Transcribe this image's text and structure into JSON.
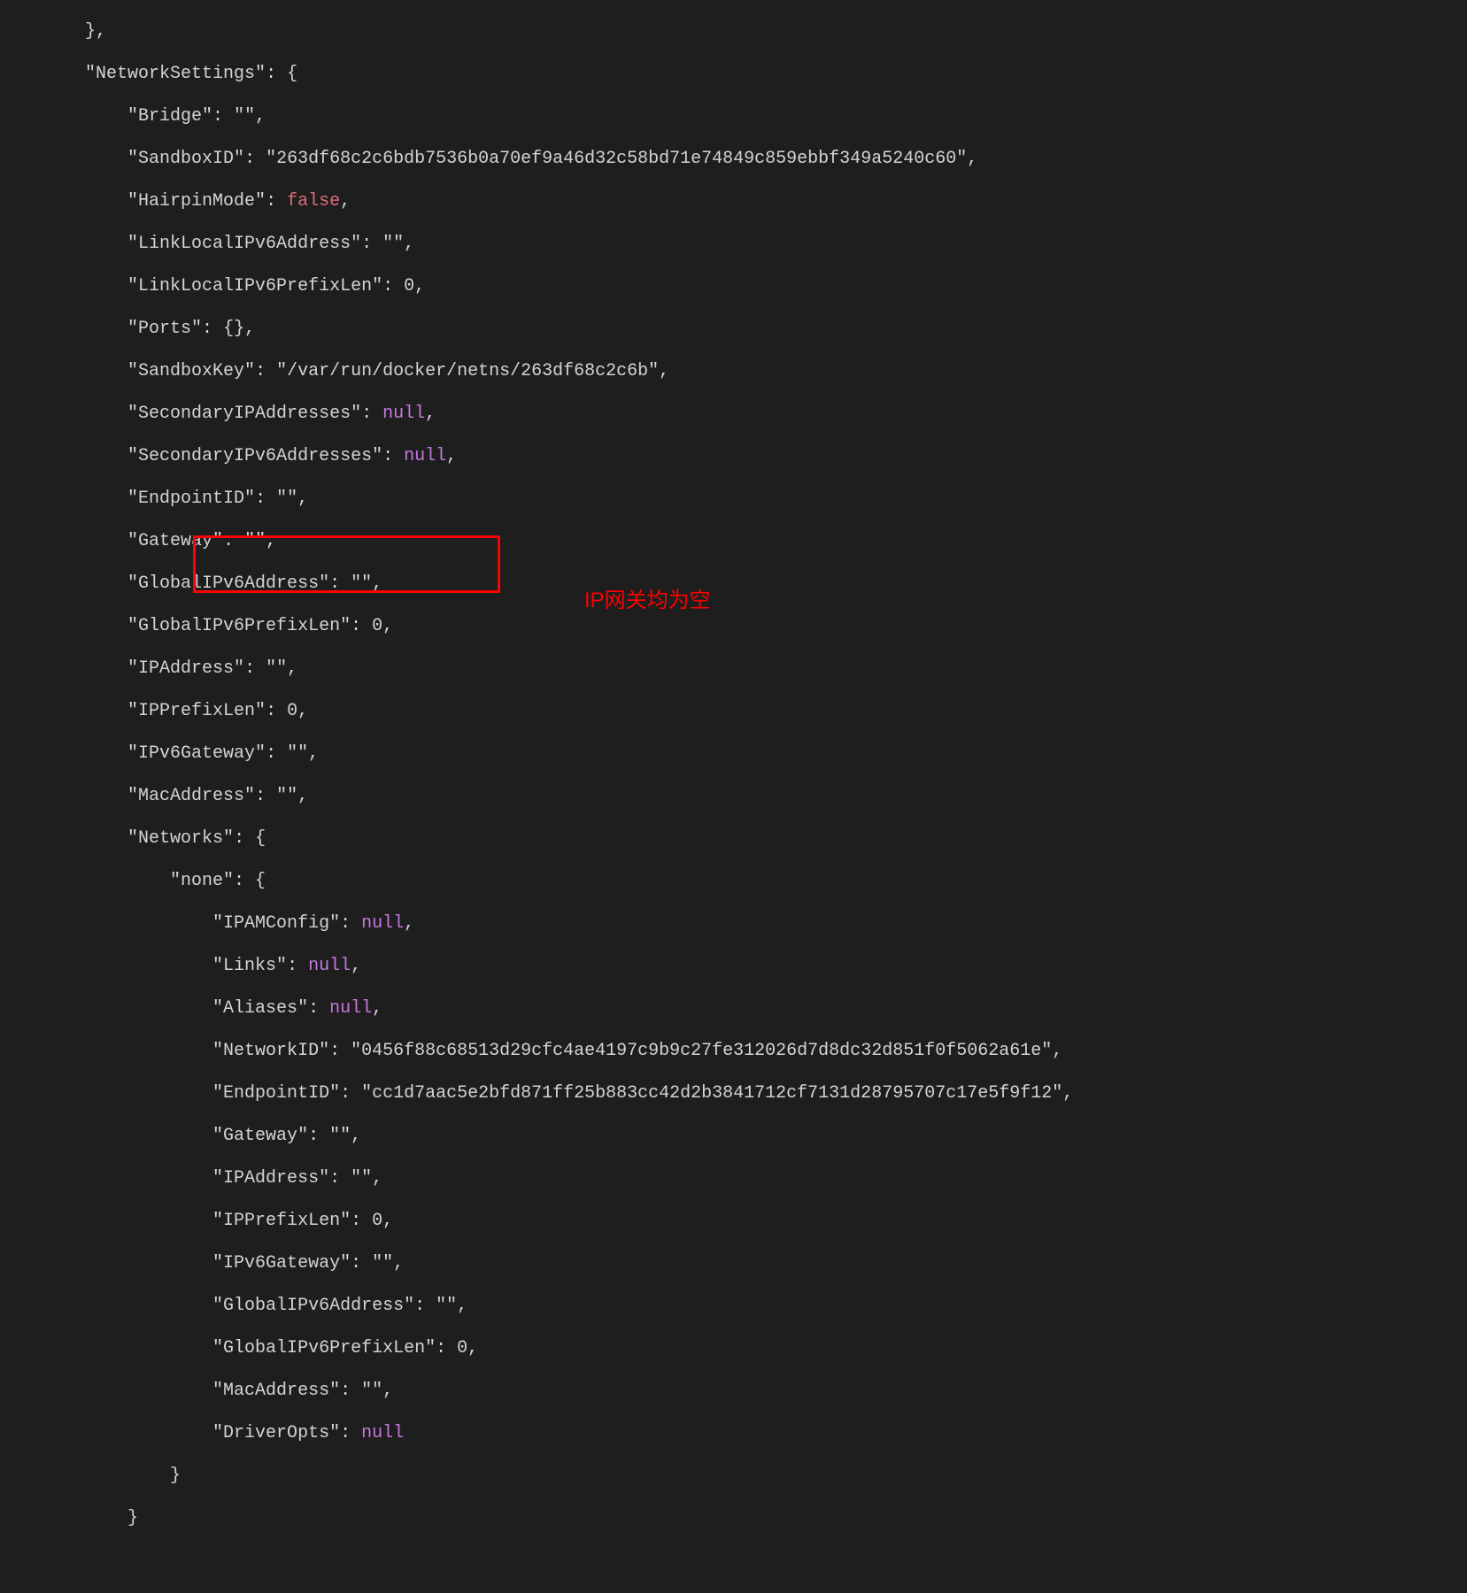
{
  "json_output": {
    "keys": {
      "networkSettings": "\"NetworkSettings\"",
      "bridge": "\"Bridge\"",
      "sandboxId": "\"SandboxID\"",
      "hairpinMode": "\"HairpinMode\"",
      "linkLocalIPv6Address": "\"LinkLocalIPv6Address\"",
      "linkLocalIPv6PrefixLen": "\"LinkLocalIPv6PrefixLen\"",
      "ports": "\"Ports\"",
      "sandboxKey": "\"SandboxKey\"",
      "secondaryIPAddresses": "\"SecondaryIPAddresses\"",
      "secondaryIPv6Addresses": "\"SecondaryIPv6Addresses\"",
      "endpointID": "\"EndpointID\"",
      "gateway": "\"Gateway\"",
      "globalIPv6Address": "\"GlobalIPv6Address\"",
      "globalIPv6PrefixLen": "\"GlobalIPv6PrefixLen\"",
      "ipAddress": "\"IPAddress\"",
      "ipPrefixLen": "\"IPPrefixLen\"",
      "ipv6Gateway": "\"IPv6Gateway\"",
      "macAddress": "\"MacAddress\"",
      "networks": "\"Networks\"",
      "none": "\"none\"",
      "ipamConfig": "\"IPAMConfig\"",
      "links": "\"Links\"",
      "aliases": "\"Aliases\"",
      "networkID": "\"NetworkID\"",
      "driverOpts": "\"DriverOpts\""
    },
    "values": {
      "empty": "\"\"",
      "sandboxIdVal": "\"263df68c2c6bdb7536b0a70ef9a46d32c58bd71e74849c859ebbf349a5240c60\"",
      "falseVal": "false",
      "zero": "0",
      "emptyObj": "{}",
      "sandboxKeyVal": "\"/var/run/docker/netns/263df68c2c6b\"",
      "nullVal": "null",
      "networkIDVal": "\"0456f88c68513d29cfc4ae4197c9b9c27fe312026d7d8dc32d851f0f5062a61e\"",
      "endpointIDVal": "\"cc1d7aac5e2bfd871ff25b883cc42d2b3841712cf7131d28795707c17e5f9f12\""
    }
  },
  "annotation": {
    "text": "IP网关均为空"
  }
}
